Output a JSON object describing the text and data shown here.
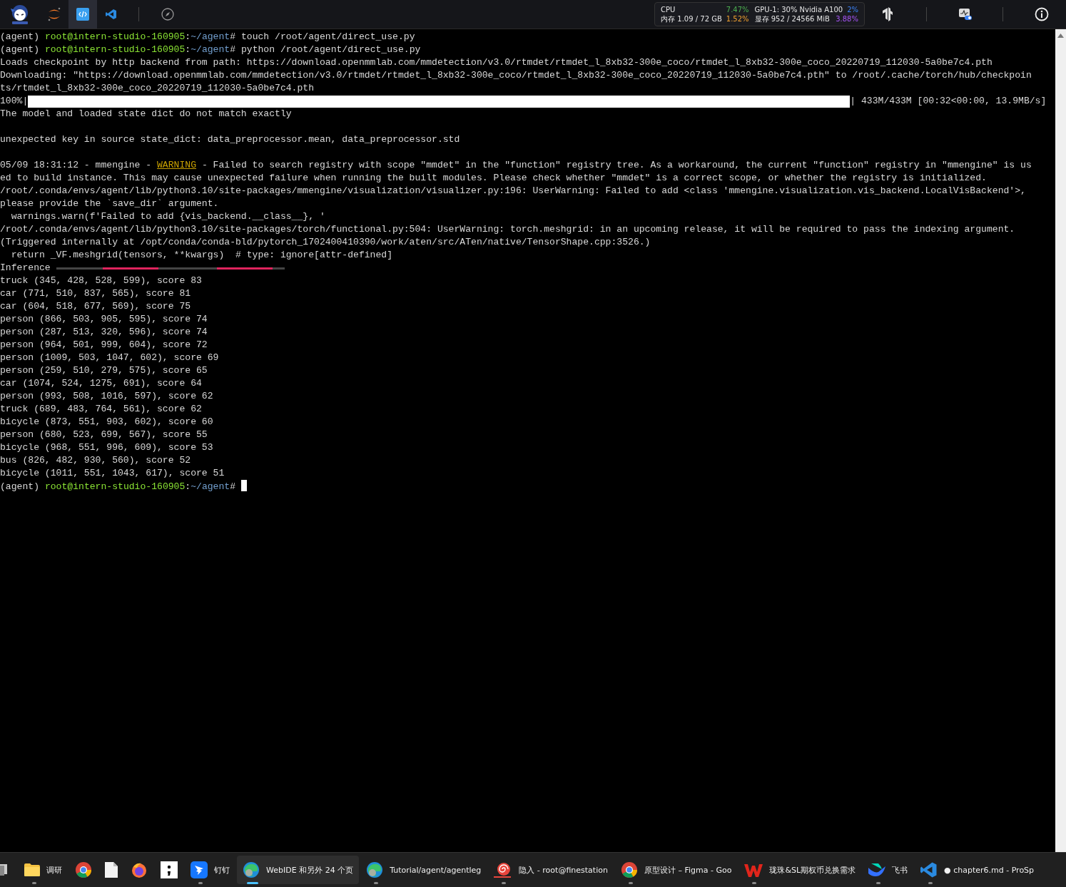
{
  "top_bar": {
    "apps": [
      {
        "kind": "mascot",
        "selected": false
      },
      {
        "kind": "jupyter",
        "selected": false
      },
      {
        "kind": "code",
        "selected": true
      },
      {
        "kind": "vscode",
        "selected": false
      },
      {
        "kind": "compass",
        "selected": false
      }
    ],
    "stats": [
      {
        "label": "CPU",
        "value": "7.47%",
        "color": "#4caf50"
      },
      {
        "label": "内存 1.09 / 72 GB",
        "value": "1.52%",
        "color": "#f0a030"
      },
      {
        "label": "GPU-1: 30% Nvidia A100",
        "value": "2%",
        "color": "#3b82f6"
      },
      {
        "label": "显存 952 / 24566 MiB",
        "value": "3.88%",
        "color": "#a855f7"
      }
    ],
    "tools": [
      {
        "kind": "tensorflow"
      },
      {
        "kind": "monitor"
      },
      {
        "kind": "info"
      }
    ]
  },
  "terminal": {
    "lines": [
      {
        "kind": "prompt",
        "env": "(agent) ",
        "user": "root@intern-studio-160905",
        "sep": ":",
        "path": "~/agent",
        "command": "# touch /root/agent/direct_use.py",
        "cursor": false
      },
      {
        "kind": "prompt",
        "env": "(agent) ",
        "user": "root@intern-studio-160905",
        "sep": ":",
        "path": "~/agent",
        "command": "# python /root/agent/direct_use.py",
        "cursor": false
      },
      {
        "kind": "text",
        "text": "Loads checkpoint by http backend from path: https://download.openmmlab.com/mmdetection/v3.0/rtmdet/rtmdet_l_8xb32-300e_coco/rtmdet_l_8xb32-300e_coco_20220719_112030-5a0be7c4.pth"
      },
      {
        "kind": "text",
        "text": "Downloading: \"https://download.openmmlab.com/mmdetection/v3.0/rtmdet/rtmdet_l_8xb32-300e_coco/rtmdet_l_8xb32-300e_coco_20220719_112030-5a0be7c4.pth\" to /root/.cache/torch/hub/checkpoin"
      },
      {
        "kind": "text",
        "text": "ts/rtmdet_l_8xb32-300e_coco_20220719_112030-5a0be7c4.pth"
      },
      {
        "kind": "progress",
        "percent": "100%|",
        "level": 1,
        "reading": "| 433M/433M [00:32<00:00, 13.9MB/s]"
      },
      {
        "kind": "text",
        "text": "The model and loaded state dict do not match exactly"
      },
      {
        "kind": "blank"
      },
      {
        "kind": "text",
        "text": "unexpected key in source state_dict: data_preprocessor.mean, data_preprocessor.std"
      },
      {
        "kind": "blank"
      },
      {
        "kind": "log",
        "before": "05/09 18:31:12 - mmengine - ",
        "level": "WARNING",
        "after": " - Failed to search registry with scope \"mmdet\" in the \"function\" registry tree. As a workaround, the current \"function\" registry in \"mmengine\" is us"
      },
      {
        "kind": "text",
        "text": "ed to build instance. This may cause unexpected failure when running the built modules. Please check whether \"mmdet\" is a correct scope, or whether the registry is initialized."
      },
      {
        "kind": "text",
        "text": "/root/.conda/envs/agent/lib/python3.10/site-packages/mmengine/visualization/visualizer.py:196: UserWarning: Failed to add <class 'mmengine.visualization.vis_backend.LocalVisBackend'>,"
      },
      {
        "kind": "text",
        "text": "please provide the `save_dir` argument."
      },
      {
        "kind": "text",
        "text": "  warnings.warn(f'Failed to add {vis_backend.__class__}, '"
      },
      {
        "kind": "text",
        "text": "/root/.conda/envs/agent/lib/python3.10/site-packages/torch/functional.py:504: UserWarning: torch.meshgrid: in an upcoming release, it will be required to pass the indexing argument."
      },
      {
        "kind": "text",
        "text": "(Triggered internally at /opt/conda/conda-bld/pytorch_1702400410390/work/aten/src/ATen/native/TensorShape.cpp:3526.)"
      },
      {
        "kind": "text",
        "text": "  return _VF.meshgrid(tensors, **kwargs)  # type: ignore[attr-defined]"
      },
      {
        "kind": "spinner",
        "text": "Inference"
      },
      {
        "kind": "text",
        "text": "truck (345, 428, 528, 599), score 83"
      },
      {
        "kind": "text",
        "text": "car (771, 510, 837, 565), score 81"
      },
      {
        "kind": "text",
        "text": "car (604, 518, 677, 569), score 75"
      },
      {
        "kind": "text",
        "text": "person (866, 503, 905, 595), score 74"
      },
      {
        "kind": "text",
        "text": "person (287, 513, 320, 596), score 74"
      },
      {
        "kind": "text",
        "text": "person (964, 501, 999, 604), score 72"
      },
      {
        "kind": "text",
        "text": "person (1009, 503, 1047, 602), score 69"
      },
      {
        "kind": "text",
        "text": "person (259, 510, 279, 575), score 65"
      },
      {
        "kind": "text",
        "text": "car (1074, 524, 1275, 691), score 64"
      },
      {
        "kind": "text",
        "text": "person (993, 508, 1016, 597), score 62"
      },
      {
        "kind": "text",
        "text": "truck (689, 483, 764, 561), score 62"
      },
      {
        "kind": "text",
        "text": "bicycle (873, 551, 903, 602), score 60"
      },
      {
        "kind": "text",
        "text": "person (680, 523, 699, 567), score 55"
      },
      {
        "kind": "text",
        "text": "bicycle (968, 551, 996, 609), score 53"
      },
      {
        "kind": "text",
        "text": "bus (826, 482, 930, 560), score 52"
      },
      {
        "kind": "text",
        "text": "bicycle (1011, 551, 1043, 617), score 51"
      },
      {
        "kind": "prompt",
        "env": "(agent) ",
        "user": "root@intern-studio-160905",
        "sep": ":",
        "path": "~/agent",
        "command": "# ",
        "cursor": true
      }
    ]
  },
  "taskbar": {
    "items": [
      {
        "kind": "windows",
        "running": false,
        "selected": false
      },
      {
        "kind": "folder",
        "label": "调研",
        "running": true,
        "selected": false
      },
      {
        "kind": "chrome",
        "running": false,
        "selected": false
      },
      {
        "kind": "file",
        "running": false,
        "selected": false
      },
      {
        "kind": "firefox",
        "running": false,
        "selected": false
      },
      {
        "kind": "semicolon",
        "running": false,
        "selected": false
      },
      {
        "kind": "dingtalk",
        "label": "钉钉",
        "running": true,
        "selected": false
      },
      {
        "kind": "edge",
        "label": "WebIDE 和另外 24 个页",
        "running": true,
        "selected": true
      },
      {
        "kind": "edge",
        "label": "Tutorial/agent/agentleg",
        "running": true,
        "selected": false
      },
      {
        "kind": "snail",
        "label": "隐入 - root@finestation",
        "running": true,
        "selected": false
      },
      {
        "kind": "chrome",
        "label": "原型设计 – Figma - Goo",
        "running": true,
        "selected": false
      },
      {
        "kind": "wps",
        "label": "珑珠&SL期权币兑换需求",
        "running": true,
        "selected": false
      },
      {
        "kind": "feishu",
        "label": "飞书",
        "running": true,
        "selected": false
      },
      {
        "kind": "vscode",
        "label": "● chapter6.md - ProSp",
        "running": true,
        "selected": false
      }
    ]
  }
}
